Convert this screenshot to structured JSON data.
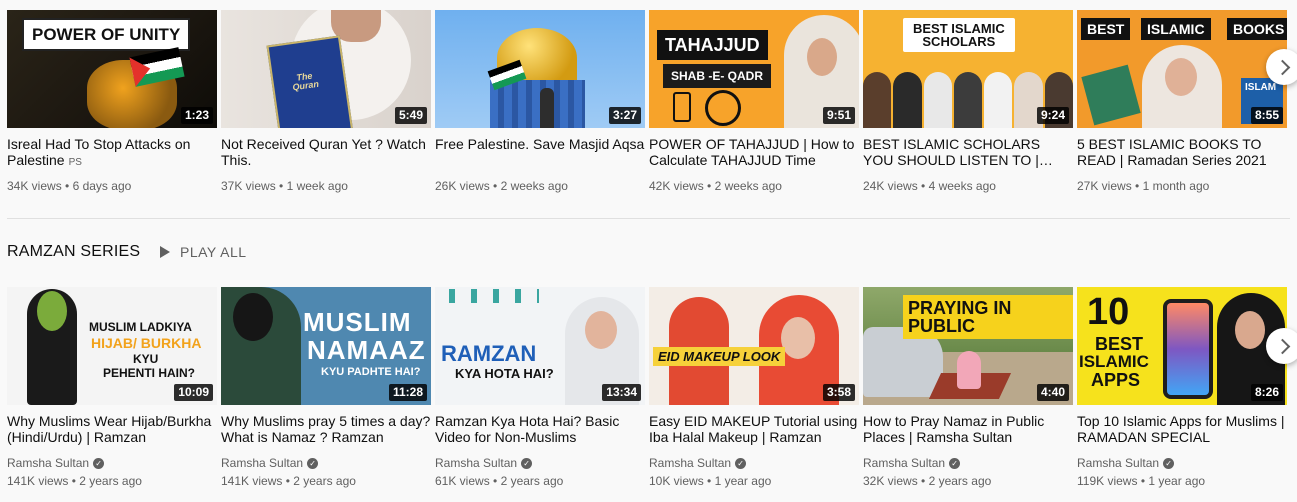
{
  "row1": [
    {
      "title": "Isreal Had To Stop Attacks on Palestine",
      "badge": "PS",
      "views": "34K views",
      "age": "6 days ago",
      "duration": "1:23",
      "overlay": [
        "POWER OF UNITY"
      ]
    },
    {
      "title": "Not Received Quran Yet ? Watch This.",
      "views": "37K views",
      "age": "1 week ago",
      "duration": "5:49",
      "overlay": [
        "The",
        "Quran"
      ]
    },
    {
      "title": "Free Palestine. Save Masjid Aqsa",
      "views": "26K views",
      "age": "2 weeks ago",
      "duration": "3:27",
      "overlay": []
    },
    {
      "title": "POWER OF TAHAJJUD | How to Calculate TAHAJJUD Time",
      "views": "42K views",
      "age": "2 weeks ago",
      "duration": "9:51",
      "overlay": [
        "TAHAJJUD",
        "SHAB -E- QADR"
      ]
    },
    {
      "title": "BEST ISLAMIC SCHOLARS YOU SHOULD LISTEN TO | Ramadan",
      "views": "24K views",
      "age": "4 weeks ago",
      "duration": "9:24",
      "overlay": [
        "BEST ISLAMIC",
        "SCHOLARS"
      ]
    },
    {
      "title": "5 BEST ISLAMIC BOOKS TO READ | Ramadan Series 2021",
      "views": "27K views",
      "age": "1 month ago",
      "duration": "8:55",
      "overlay": [
        "BEST",
        "ISLAMIC",
        "BOOKS",
        "ISLAM"
      ]
    }
  ],
  "shelf": {
    "title": "RAMZAN SERIES",
    "play_all": "PLAY ALL"
  },
  "row2": [
    {
      "title": "Why Muslims Wear Hijab/Burkha (Hindi/Urdu) | Ramzan",
      "channel": "Ramsha Sultan",
      "views": "141K views",
      "age": "2 years ago",
      "duration": "10:09",
      "overlay": [
        "MUSLIM LADKIYA",
        "HIJAB/ BURKHA",
        "KYU",
        "PEHENTI HAIN?"
      ]
    },
    {
      "title": "Why Muslims pray 5 times a day? What is Namaz ? Ramzan",
      "channel": "Ramsha Sultan",
      "views": "141K views",
      "age": "2 years ago",
      "duration": "11:28",
      "overlay": [
        "MUSLIM",
        "NAMAAZ",
        "KYU PADHTE HAI?"
      ]
    },
    {
      "title": "Ramzan Kya Hota Hai? Basic Video for Non-Muslims",
      "channel": "Ramsha Sultan",
      "views": "61K views",
      "age": "2 years ago",
      "duration": "13:34",
      "overlay": [
        "RAMZAN",
        "KYA HOTA HAI?"
      ]
    },
    {
      "title": "Easy EID MAKEUP Tutorial using Iba Halal Makeup | Ramzan",
      "channel": "Ramsha Sultan",
      "views": "10K views",
      "age": "1 year ago",
      "duration": "3:58",
      "overlay": [
        "EID MAKEUP LOOK"
      ]
    },
    {
      "title": "How to Pray Namaz in Public Places | Ramsha Sultan",
      "channel": "Ramsha Sultan",
      "views": "32K views",
      "age": "2 years ago",
      "duration": "4:40",
      "overlay": [
        "PRAYING IN PUBLIC"
      ]
    },
    {
      "title": "Top 10 Islamic Apps for Muslims | RAMADAN SPECIAL",
      "channel": "Ramsha Sultan",
      "views": "119K views",
      "age": "1 year ago",
      "duration": "8:26",
      "overlay": [
        "10",
        "BEST",
        "ISLAMIC",
        "APPS"
      ]
    }
  ],
  "icons": {
    "next": "chevron-right-icon",
    "play": "play-icon",
    "verified": "verified-check-icon"
  },
  "colors": {
    "duration_bg": "#000000",
    "meta_text": "#606060",
    "page_bg": "#f9f9f9"
  }
}
